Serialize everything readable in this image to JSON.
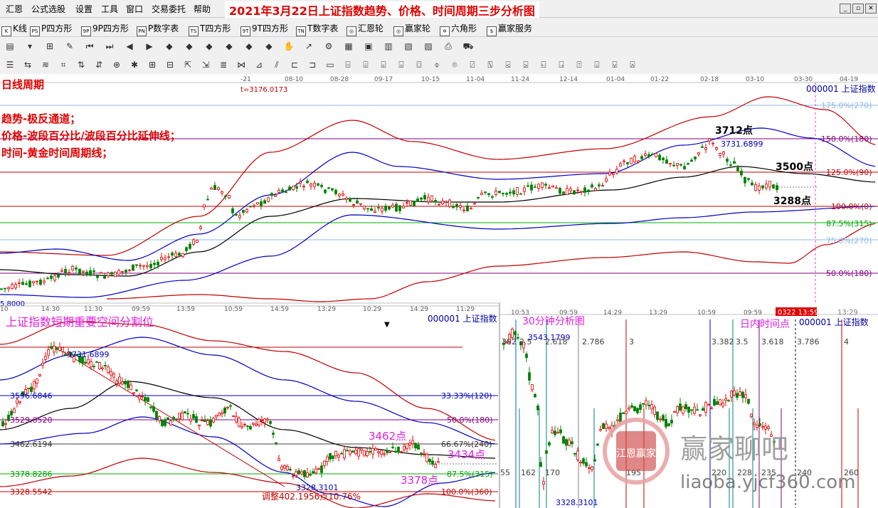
{
  "menu": {
    "items": [
      "汇恩",
      "公式选股",
      "设置",
      "工具",
      "窗口",
      "交易委托",
      "帮助"
    ],
    "banner": "2021年3月22日上证指数趋势、价格、时间周期三步分析图",
    "window_buttons": [
      "_",
      "▫",
      "✕"
    ]
  },
  "toolbar": {
    "items": [
      {
        "icon": "K",
        "label": "K线"
      },
      {
        "icon": "PS",
        "label": "P四方形"
      },
      {
        "icon": "9P",
        "label": "9P四方形"
      },
      {
        "icon": "PN",
        "label": "P数字表"
      },
      {
        "icon": "TS",
        "label": "T四方形"
      },
      {
        "icon": "9T",
        "label": "9T四方形"
      },
      {
        "icon": "TN",
        "label": "T数字表"
      },
      {
        "icon": "◎",
        "label": "汇恩轮"
      },
      {
        "icon": "◎",
        "label": "赢家轮"
      },
      {
        "icon": "✡",
        "label": "六角形"
      },
      {
        "icon": "$",
        "label": "赢家服务"
      }
    ]
  },
  "colors": {
    "red_level": "#c00000",
    "green_level": "#00b000",
    "purple_level": "#800080",
    "blue_curve": "#0000c0",
    "light_blue_level": "#8fb8e8",
    "candle_up": "#e00000",
    "candle_down": "#008000",
    "annotation_red": "#e00000",
    "annotation_magenta": "#e020e0"
  },
  "top_panel": {
    "date_ticks": [
      "-21",
      "08-10",
      "08-28",
      "09-17",
      "10-15",
      "11-04",
      "11-24",
      "12-14",
      "01-04",
      "01-22",
      "02-18",
      "03-10",
      "03-30",
      "04-19"
    ],
    "time_ticks": [
      "10",
      "14:30",
      "11:30",
      "09:59",
      "13:59",
      "10:59",
      "14:59",
      "13:29",
      "10:29",
      "14:29",
      "11:29"
    ],
    "cursor_readout": "t=3176.0173",
    "low_readout": "5.8000",
    "code_label": "000001 上证指数",
    "notes": [
      "日线周期",
      "趋势-极反通道；",
      "价格-波段百分比/波段百分比延伸线；",
      "时间-黄金时间周期线；"
    ],
    "annotations": {
      "high": "3712点",
      "high_value": "3731.6899",
      "mid": "3500点",
      "low": "3288点"
    },
    "level_labels": [
      "175.0%(270)",
      "150.0%(180)",
      "125.0%(90)",
      "100.0%(0)",
      "87.5%(315)",
      "75.0%(270)",
      "50.0%(180)"
    ]
  },
  "bottom_left": {
    "title": "上证指数短期重要空间分割位",
    "code_label": "000001 上证指数",
    "high_value": "3731.6899",
    "price_levels": [
      "3596.6846",
      "3529.6520",
      "3462.6194",
      "3378.8286",
      "3328.5542"
    ],
    "pct_labels": [
      "33.33%(120)",
      "50.0%(180)",
      "66.67%(240)",
      "87.5%(315)",
      "100.0%(360)"
    ],
    "annotations": {
      "a": "3462点",
      "b": "3434点",
      "c": "3378点"
    },
    "low_value": "3328.3101",
    "adjustment": "调整402.1956点10.76%"
  },
  "bottom_right": {
    "time_ticks": [
      "10:53",
      "09:59",
      "14:29",
      "13:29",
      "10:59",
      "09:59"
    ],
    "time_highlight": "0322 13:59",
    "time_tick_last": "13:29",
    "code_label": "000001 上证指数",
    "title": "30分钟分析图",
    "title_right": "日内时间点",
    "top_value": "3543.1799",
    "low_value": "3328.3101",
    "ratios_top": [
      "382",
      "2.5",
      "2.618",
      "2.786",
      "3",
      "3.382",
      "3.5",
      "3.618",
      "3.786",
      "4"
    ],
    "ratios_bottom": [
      "55",
      "162",
      "170",
      "195",
      "220",
      "228",
      "235",
      "240",
      "260"
    ]
  },
  "watermark": {
    "brand": "赢家聊吧",
    "url": "liaoba.yjcf360.com",
    "seal": "江恩赢家"
  }
}
